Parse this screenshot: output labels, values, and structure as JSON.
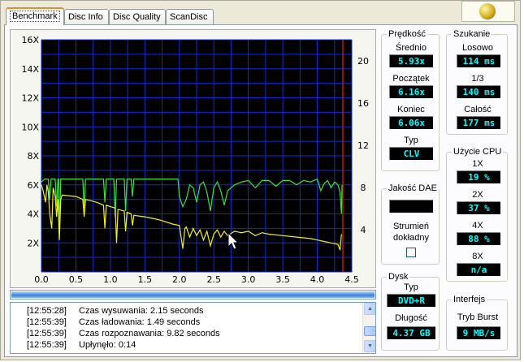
{
  "tabs": [
    {
      "label": "Benchmark",
      "active": true
    },
    {
      "label": "Disc Info"
    },
    {
      "label": "Disc Quality"
    },
    {
      "label": "ScanDisc"
    }
  ],
  "chart_data": {
    "type": "line",
    "background": "#000000",
    "grid": true,
    "grid_color": "#0b2dd6",
    "x_ticks": [
      "0.0",
      "0.5",
      "1.0",
      "1.5",
      "2.0",
      "2.5",
      "3.0",
      "3.5",
      "4.0",
      "4.5"
    ],
    "y_left_ticks": [
      "2X",
      "4X",
      "6X",
      "8X",
      "10X",
      "12X",
      "14X",
      "16X"
    ],
    "y_right_ticks": [
      "4",
      "8",
      "12",
      "16",
      "20"
    ],
    "xlim": [
      0,
      4.5
    ],
    "ylim_left": [
      0,
      16
    ],
    "ylim_right": [
      0,
      22
    ],
    "series": [
      {
        "color": "#3ee03e",
        "values": [
          [
            0,
            6.2
          ],
          [
            0.05,
            6.4
          ],
          [
            0.1,
            6.4
          ],
          [
            0.12,
            5.0
          ],
          [
            0.14,
            6.4
          ],
          [
            0.2,
            6.4
          ],
          [
            0.22,
            4.5
          ],
          [
            0.24,
            6.4
          ],
          [
            0.25,
            6.4
          ],
          [
            0.26,
            2.8
          ],
          [
            0.28,
            6.4
          ],
          [
            0.6,
            6.4
          ],
          [
            0.62,
            4.4
          ],
          [
            0.64,
            6.4
          ],
          [
            0.9,
            6.4
          ],
          [
            0.92,
            4.8
          ],
          [
            0.94,
            6.4
          ],
          [
            1.05,
            6.4
          ],
          [
            1.07,
            3.8
          ],
          [
            1.09,
            6.4
          ],
          [
            1.2,
            6.4
          ],
          [
            1.22,
            4.2
          ],
          [
            1.24,
            6.4
          ],
          [
            1.3,
            6.4
          ],
          [
            1.32,
            5.2
          ],
          [
            1.34,
            6.4
          ],
          [
            1.98,
            6.4
          ],
          [
            2.0,
            5.2
          ],
          [
            2.05,
            4.5
          ],
          [
            2.1,
            5.0
          ],
          [
            2.15,
            6.0
          ],
          [
            2.2,
            5.8
          ],
          [
            2.25,
            4.8
          ],
          [
            2.3,
            6.0
          ],
          [
            2.35,
            6.2
          ],
          [
            2.4,
            5.5
          ],
          [
            2.45,
            4.2
          ],
          [
            2.5,
            5.8
          ],
          [
            2.55,
            6.2
          ],
          [
            2.6,
            5.6
          ],
          [
            2.65,
            4.6
          ],
          [
            2.7,
            5.6
          ],
          [
            2.8,
            6.0
          ],
          [
            2.9,
            6.2
          ],
          [
            3.0,
            6.3
          ],
          [
            3.1,
            5.8
          ],
          [
            3.2,
            6.3
          ],
          [
            3.3,
            6.3
          ],
          [
            3.4,
            5.9
          ],
          [
            3.5,
            6.3
          ],
          [
            3.6,
            6.3
          ],
          [
            3.7,
            6.0
          ],
          [
            3.8,
            6.3
          ],
          [
            3.9,
            6.2
          ],
          [
            4.0,
            6.4
          ],
          [
            4.05,
            5.6
          ],
          [
            4.1,
            6.1
          ],
          [
            4.15,
            6.3
          ],
          [
            4.2,
            5.8
          ],
          [
            4.25,
            6.2
          ],
          [
            4.3,
            6.0
          ],
          [
            4.33,
            5.5
          ],
          [
            4.35,
            4.0
          ],
          [
            4.36,
            6.0
          ]
        ]
      },
      {
        "color": "#f0f020",
        "values": [
          [
            0,
            6.0
          ],
          [
            0.03,
            5.5
          ],
          [
            0.06,
            4.8
          ],
          [
            0.08,
            6.0
          ],
          [
            0.1,
            5.5
          ],
          [
            0.12,
            4.0
          ],
          [
            0.15,
            3.0
          ],
          [
            0.17,
            5.8
          ],
          [
            0.2,
            5.2
          ],
          [
            0.22,
            3.8
          ],
          [
            0.24,
            5.0
          ],
          [
            0.26,
            2.2
          ],
          [
            0.28,
            5.0
          ],
          [
            0.3,
            5.3
          ],
          [
            0.5,
            5.2
          ],
          [
            0.6,
            5.0
          ],
          [
            0.62,
            3.8
          ],
          [
            0.64,
            5.0
          ],
          [
            0.8,
            4.8
          ],
          [
            0.9,
            4.6
          ],
          [
            0.92,
            3.0
          ],
          [
            0.94,
            4.6
          ],
          [
            1.0,
            4.5
          ],
          [
            1.07,
            4.4
          ],
          [
            1.09,
            2.0
          ],
          [
            1.11,
            4.3
          ],
          [
            1.2,
            4.2
          ],
          [
            1.22,
            2.8
          ],
          [
            1.24,
            4.1
          ],
          [
            1.3,
            4.0
          ],
          [
            1.32,
            3.2
          ],
          [
            1.34,
            3.9
          ],
          [
            1.5,
            3.8
          ],
          [
            1.7,
            3.6
          ],
          [
            1.9,
            3.3
          ],
          [
            2.0,
            3.2
          ],
          [
            2.05,
            1.6
          ],
          [
            2.08,
            3.0
          ],
          [
            2.1,
            3.1
          ],
          [
            2.15,
            2.4
          ],
          [
            2.2,
            3.0
          ],
          [
            2.25,
            2.5
          ],
          [
            2.3,
            2.9
          ],
          [
            2.35,
            2.2
          ],
          [
            2.4,
            2.8
          ],
          [
            2.45,
            1.8
          ],
          [
            2.5,
            2.6
          ],
          [
            2.55,
            2.9
          ],
          [
            2.6,
            2.4
          ],
          [
            2.65,
            2.8
          ],
          [
            2.7,
            2.5
          ],
          [
            2.8,
            2.8
          ],
          [
            2.9,
            2.7
          ],
          [
            3.0,
            2.8
          ],
          [
            3.1,
            2.5
          ],
          [
            3.2,
            2.7
          ],
          [
            3.3,
            2.6
          ],
          [
            3.5,
            2.5
          ],
          [
            3.7,
            2.4
          ],
          [
            3.9,
            2.3
          ],
          [
            4.0,
            2.2
          ],
          [
            4.1,
            2.1
          ],
          [
            4.2,
            2.0
          ],
          [
            4.3,
            1.9
          ],
          [
            4.33,
            1.5
          ],
          [
            4.35,
            2.6
          ]
        ]
      }
    ],
    "end_marker_x": 4.37,
    "end_marker_color": "#d01010"
  },
  "progress": {
    "percent": 100
  },
  "log": [
    {
      "time": "[12:55:28]",
      "text": "Czas wysuwania: 2.15 seconds"
    },
    {
      "time": "[12:55:39]",
      "text": "Czas ładowania: 1.49 seconds"
    },
    {
      "time": "[12:55:39]",
      "text": "Czas rozpoznawania: 9.82 seconds"
    },
    {
      "time": "[12:55:39]",
      "text": "Upłynęło: 0:14"
    }
  ],
  "speed": {
    "title": "Prędkość",
    "avg_label": "Średnio",
    "avg_value": "5.93x",
    "start_label": "Początek",
    "start_value": "6.16x",
    "end_label": "Koniec",
    "end_value": "6.06x",
    "type_label": "Typ",
    "type_value": "CLV"
  },
  "seek": {
    "title": "Szukanie",
    "random_label": "Losowo",
    "random_value": "114 ms",
    "third_label": "1/3",
    "third_value": "140 ms",
    "full_label": "Całość",
    "full_value": "177 ms"
  },
  "dae": {
    "title": "Jakość DAE",
    "value": "",
    "stream_label": "Strumień",
    "exact_label": "dokładny",
    "checked": false
  },
  "cpu": {
    "title": "Użycie CPU",
    "x1_label": "1X",
    "x1_value": "19 %",
    "x2_label": "2X",
    "x2_value": "37 %",
    "x4_label": "4X",
    "x4_value": "88 %",
    "x8_label": "8X",
    "x8_value": "n/a"
  },
  "disc": {
    "title": "Dysk",
    "type_label": "Typ",
    "type_value": "DVD+R",
    "length_label": "Długość",
    "length_value": "4.37 GB"
  },
  "interface": {
    "title": "Interfejs",
    "burst_label": "Tryb Burst",
    "burst_value": "9 MB/s"
  }
}
